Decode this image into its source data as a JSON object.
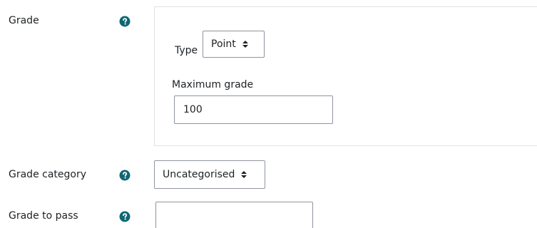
{
  "grade": {
    "label": "Grade",
    "type_label": "Type",
    "type_value": "Point",
    "max_grade_label": "Maximum grade",
    "max_grade_value": "100"
  },
  "grade_category": {
    "label": "Grade category",
    "value": "Uncategorised"
  },
  "grade_to_pass": {
    "label": "Grade to pass",
    "value": ""
  },
  "icons": {
    "help": "question-circle-icon"
  },
  "colors": {
    "help_icon": "#0f6674",
    "text": "#1d2125",
    "input_border": "#8f959e",
    "box_border": "#dee2e6"
  }
}
